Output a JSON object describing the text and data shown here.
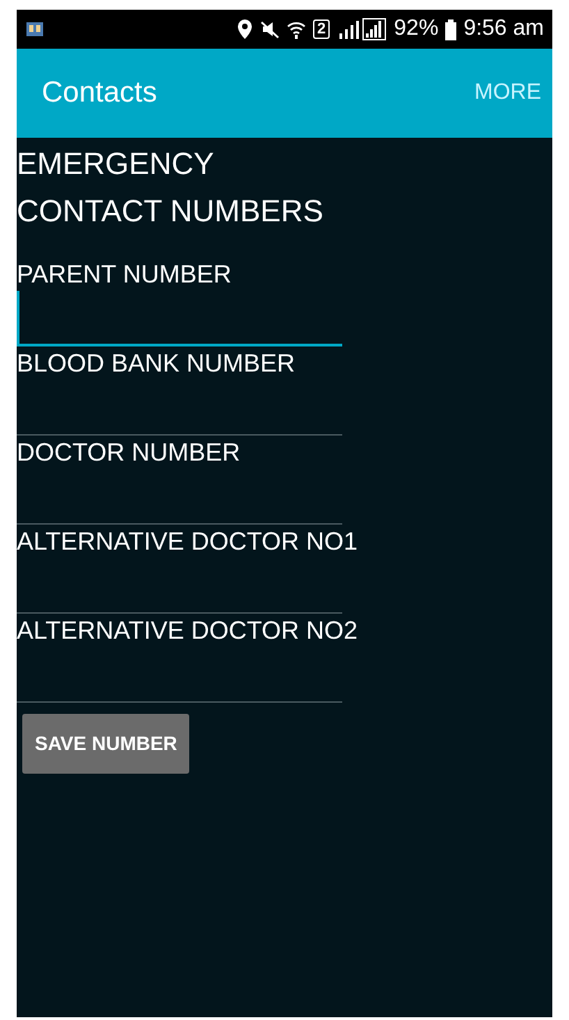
{
  "status_bar": {
    "sim_slot": "2",
    "battery": "92%",
    "time": "9:56 am"
  },
  "app_bar": {
    "title": "Contacts",
    "menu": "MORE"
  },
  "heading": "EMERGENCY CONTACT NUMBERS",
  "fields": [
    {
      "label": "PARENT NUMBER",
      "focused": true
    },
    {
      "label": "BLOOD BANK NUMBER",
      "focused": false
    },
    {
      "label": "DOCTOR NUMBER",
      "focused": false
    },
    {
      "label": "ALTERNATIVE DOCTOR NO1",
      "focused": false
    },
    {
      "label": "ALTERNATIVE DOCTOR NO2",
      "focused": false
    }
  ],
  "save_button": "SAVE NUMBER"
}
